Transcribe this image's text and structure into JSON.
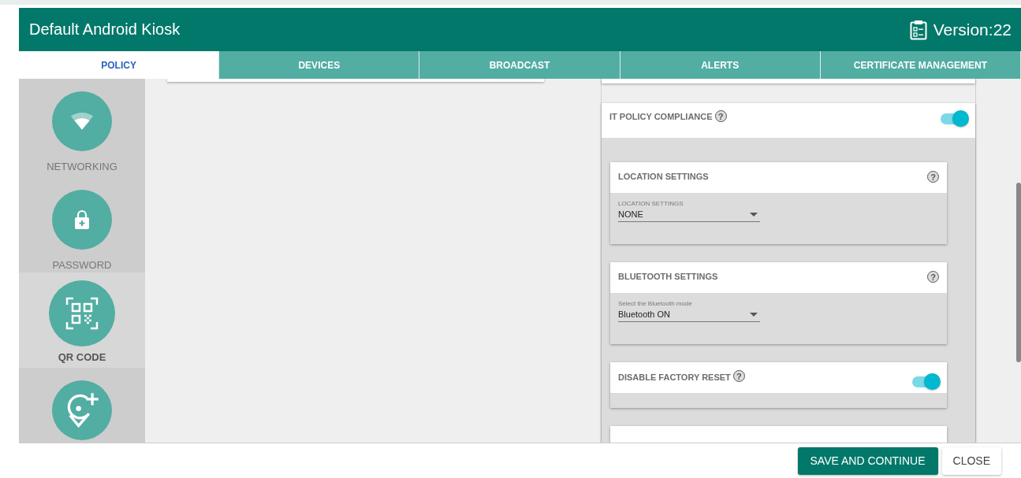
{
  "dialog": {
    "title": "Default Android Kiosk",
    "version": "Version:22"
  },
  "tabs": [
    {
      "label": "POLICY",
      "selected": true
    },
    {
      "label": "DEVICES",
      "selected": false
    },
    {
      "label": "BROADCAST",
      "selected": false
    },
    {
      "label": "ALERTS",
      "selected": false
    },
    {
      "label": "CERTIFICATE MANAGEMENT",
      "selected": false
    }
  ],
  "sidebar": {
    "items": [
      {
        "kind": "wifi",
        "label": "NETWORKING",
        "selected": false
      },
      {
        "kind": "lock",
        "label": "PASSWORD",
        "selected": false
      },
      {
        "kind": "qr",
        "label": "QR CODE",
        "selected": true
      },
      {
        "kind": "pin",
        "selected": false
      }
    ]
  },
  "sections": [
    {
      "kind": "toggle",
      "title": "IT POLICY COMPLIANCE",
      "help": "?",
      "on": true,
      "children": [
        {
          "kind": "select",
          "title": "LOCATION SETTINGS",
          "help": "?",
          "field_label": "LOCATION SETTINGS",
          "value": "NONE"
        },
        {
          "kind": "select",
          "title": "BLUETOOTH SETTINGS",
          "help": "?",
          "field_label": "Select the Bluetooth mode",
          "value": "Bluetooth ON"
        },
        {
          "kind": "toggle",
          "title": "DISABLE FACTORY RESET",
          "help": "?",
          "on": true
        },
        {
          "kind": "partial"
        }
      ]
    }
  ],
  "footer": {
    "buttons": [
      {
        "label": "SAVE AND CONTINUE",
        "kind": "primary"
      },
      {
        "label": "CLOSE",
        "kind": "secondary"
      }
    ]
  }
}
